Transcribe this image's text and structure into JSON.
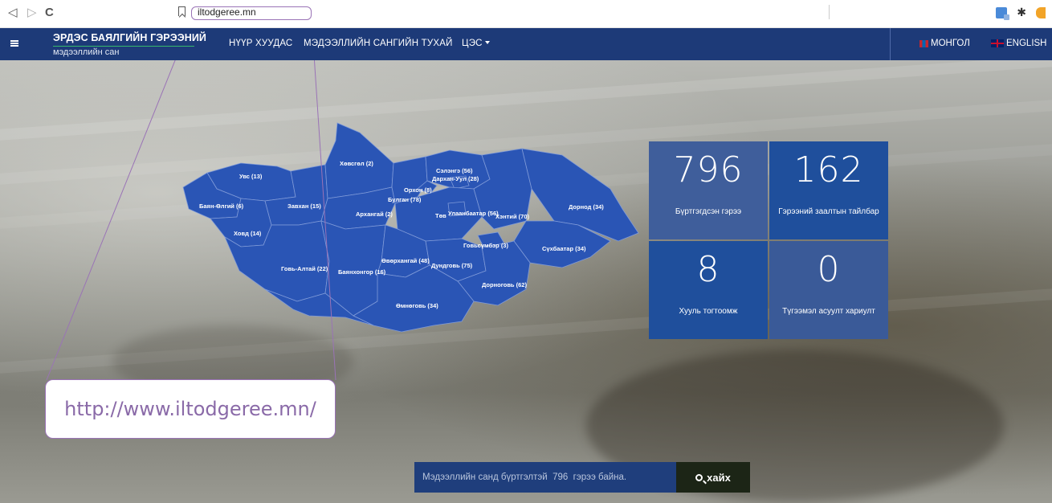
{
  "browser": {
    "url": "iltodgeree.mn"
  },
  "header": {
    "logo_title": "ЭРДЭС БАЯЛГИЙН ГЭРЭЭНИЙ",
    "logo_subtitle": "мэдээллийн сан",
    "nav": [
      {
        "label": "НҮҮР ХУУДАС"
      },
      {
        "label": "МЭДЭЭЛЛИЙН САНГИЙН ТУХАЙ"
      },
      {
        "label": "ЦЭС"
      }
    ],
    "lang_mn": "МОНГОЛ",
    "lang_en": "ENGLISH"
  },
  "map": {
    "provinces": [
      {
        "name": "Увс (13)"
      },
      {
        "name": "Хөвсгөл (2)"
      },
      {
        "name": "Сэлэнгэ (56)"
      },
      {
        "name": "Дархан-Уул (28)"
      },
      {
        "name": "Орхон (8)"
      },
      {
        "name": "Булган (78)"
      },
      {
        "name": "Баян-Өлгий (6)"
      },
      {
        "name": "Завхан (15)"
      },
      {
        "name": "Архангай (2)"
      },
      {
        "name": "Төв"
      },
      {
        "name": "Улаанбаатар (56)"
      },
      {
        "name": "Хэнтий (70)"
      },
      {
        "name": "Дорнод (34)"
      },
      {
        "name": "Ховд (14)"
      },
      {
        "name": "Говьсүмбэр (3)"
      },
      {
        "name": "Сүхбаатар (34)"
      },
      {
        "name": "Говь-Алтай (22)"
      },
      {
        "name": "Баянхонгор (16)"
      },
      {
        "name": "Өвөрхангай (48)"
      },
      {
        "name": "Дундговь (75)"
      },
      {
        "name": "Дорноговь (62)"
      },
      {
        "name": "Өмнөговь (34)"
      }
    ],
    "colors": {
      "fill": "#2a55b5",
      "border": "#7f9ad8"
    }
  },
  "stats": [
    {
      "value": "796",
      "label": "Бүртгэгдсэн гэрээ",
      "color": "#3f5e9b"
    },
    {
      "value": "162",
      "label": "Гэрээний заалтын тайлбар",
      "color": "#1f4f9c"
    },
    {
      "value": "8",
      "label": "Хууль тогтоомж",
      "color": "#1f4f9c"
    },
    {
      "value": "0",
      "label": "Түгээмэл асуулт хариулт",
      "color": "#3a5a98"
    }
  ],
  "search": {
    "placeholder": "Мэдээллийн санд бүртгэлтэй  796  гэрээ байна.",
    "button_label": "хайх"
  },
  "callout": {
    "text": "http://www.iltodgeree.mn/"
  }
}
